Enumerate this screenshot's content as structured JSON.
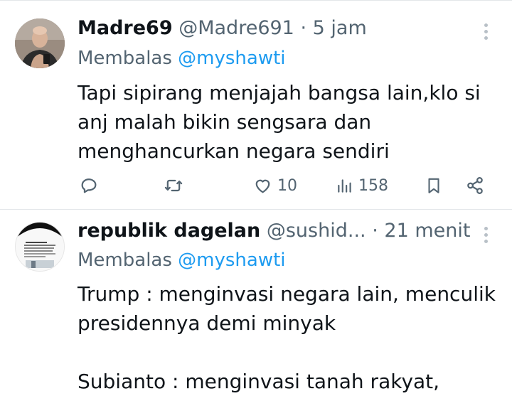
{
  "tweets": [
    {
      "display_name": "Madre69",
      "handle": "@Madre691",
      "separator": "·",
      "time": "5 jam",
      "reply_prefix": "Membalas",
      "reply_handle": "@myshawti",
      "text": "Tapi sipirang menjajah bangsa lain,klo si\nanj malah bikin sengsara dan\nmenghancurkan negara sendiri",
      "actions": {
        "likes": "10",
        "views": "158"
      }
    },
    {
      "display_name": "republik dagelan",
      "handle": "@sushid...",
      "separator": "·",
      "time": "21 menit",
      "reply_prefix": "Membalas",
      "reply_handle": "@myshawti",
      "text": "Trump : menginvasi negara lain, menculik\npresidennya demi minyak\n\nSubianto : menginvasi tanah rakyat,"
    }
  ],
  "icons": {
    "reply": "reply-icon",
    "retweet": "retweet-icon",
    "like": "heart-icon",
    "views": "views-icon",
    "bookmark": "bookmark-icon",
    "share": "share-icon",
    "more": "more-icon"
  },
  "colors": {
    "text": "#0f1419",
    "secondary": "#536471",
    "link": "#1d9bf0",
    "divider": "#e3e6e9"
  }
}
